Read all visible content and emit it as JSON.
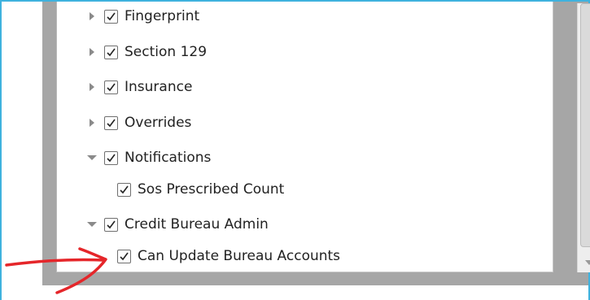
{
  "tree": {
    "items": [
      {
        "label": "Fingerprint",
        "level": 0,
        "state": "collapsed",
        "checked": true
      },
      {
        "label": "Section 129",
        "level": 0,
        "state": "collapsed",
        "checked": true
      },
      {
        "label": "Insurance",
        "level": 0,
        "state": "collapsed",
        "checked": true
      },
      {
        "label": "Overrides",
        "level": 0,
        "state": "collapsed",
        "checked": true
      },
      {
        "label": "Notifications",
        "level": 0,
        "state": "expanded",
        "checked": true
      },
      {
        "label": "Sos Prescribed Count",
        "level": 1,
        "state": "leaf",
        "checked": true
      },
      {
        "label": "Credit Bureau Admin",
        "level": 0,
        "state": "expanded",
        "checked": true
      },
      {
        "label": "Can Update Bureau Accounts",
        "level": 1,
        "state": "leaf",
        "checked": true
      }
    ]
  },
  "colors": {
    "frame_border": "#3fb2de",
    "backdrop": "#a6a6a6",
    "annotation_arrow": "#e5262a"
  },
  "icons": [
    "expand-arrow-icon",
    "collapse-arrow-icon",
    "checkmark-icon",
    "scroll-down-arrow-icon",
    "red-pointer-arrow"
  ]
}
